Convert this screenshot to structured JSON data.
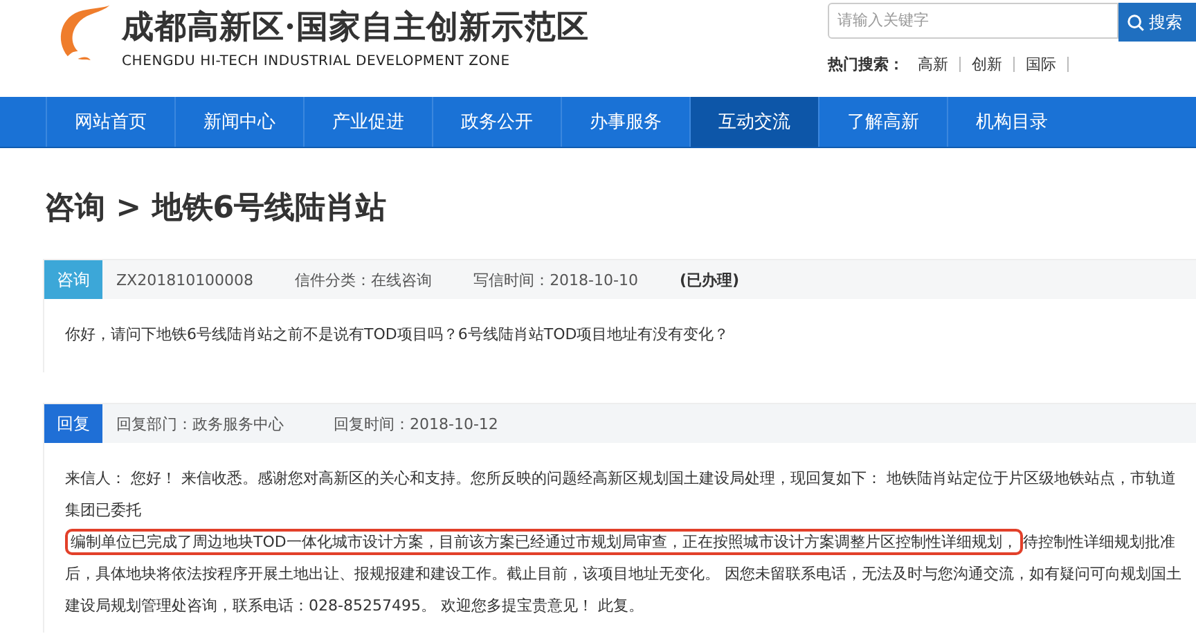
{
  "header": {
    "title": "成都高新区·国家自主创新示范区",
    "subtitle": "CHENGDU HI-TECH INDUSTRIAL DEVELOPMENT ZONE",
    "search": {
      "placeholder": "请输入关键字",
      "button": "搜索"
    },
    "hot_label": "热门搜索：",
    "hot_links": [
      "高新",
      "创新",
      "国际"
    ]
  },
  "nav": [
    {
      "label": "网站首页",
      "selected": false
    },
    {
      "label": "新闻中心",
      "selected": false
    },
    {
      "label": "产业促进",
      "selected": false
    },
    {
      "label": "政务公开",
      "selected": false
    },
    {
      "label": "办事服务",
      "selected": false
    },
    {
      "label": "互动交流",
      "selected": true
    },
    {
      "label": "了解高新",
      "selected": false
    },
    {
      "label": "机构目录",
      "selected": false
    }
  ],
  "page_title": "咨询 > 地铁6号线陆肖站",
  "letters": [
    {
      "kind": "inquiry",
      "tag": "咨询",
      "color": "#3ca7d8",
      "meta": [
        "ZX201810100008",
        "信件分类：在线咨询",
        "写信时间：2018-10-10"
      ],
      "status": "(已办理)",
      "body": {
        "before": "你好，请问下地铁6号线陆肖站之前不是说有TOD项目吗？6号线陆肖站TOD项目地址有没有变化？"
      }
    },
    {
      "kind": "reply",
      "tag": "回复",
      "color": "#1f6fd6",
      "meta": [
        "回复部门：政务服务中心",
        "回复时间：2018-10-12"
      ],
      "body": {
        "before": "来信人：  您好！ 来信收悉。感谢您对高新区的关心和支持。您所反映的问题经高新区规划国土建设局处理，现回复如下：  地铁陆肖站定位于片区级地铁站点，市轨道集团已委托",
        "highlight": "编制单位已完成了周边地块TOD一体化城市设计方案，目前该方案已经通过市规划局审查，正在按照城市设计方案调整片区控制性详细规划，",
        "after": "待控制性详细规划批准后，具体地块将依法按程序开展土地出让、报规报建和建设工作。截止目前，该项目地址无变化。 因您未留联系电话，无法及时与您沟通交流，如有疑问可向规划国土建设局规划管理处咨询，联系电话：028-85257495。 欢迎您多提宝贵意见！ 此复。"
      }
    }
  ]
}
